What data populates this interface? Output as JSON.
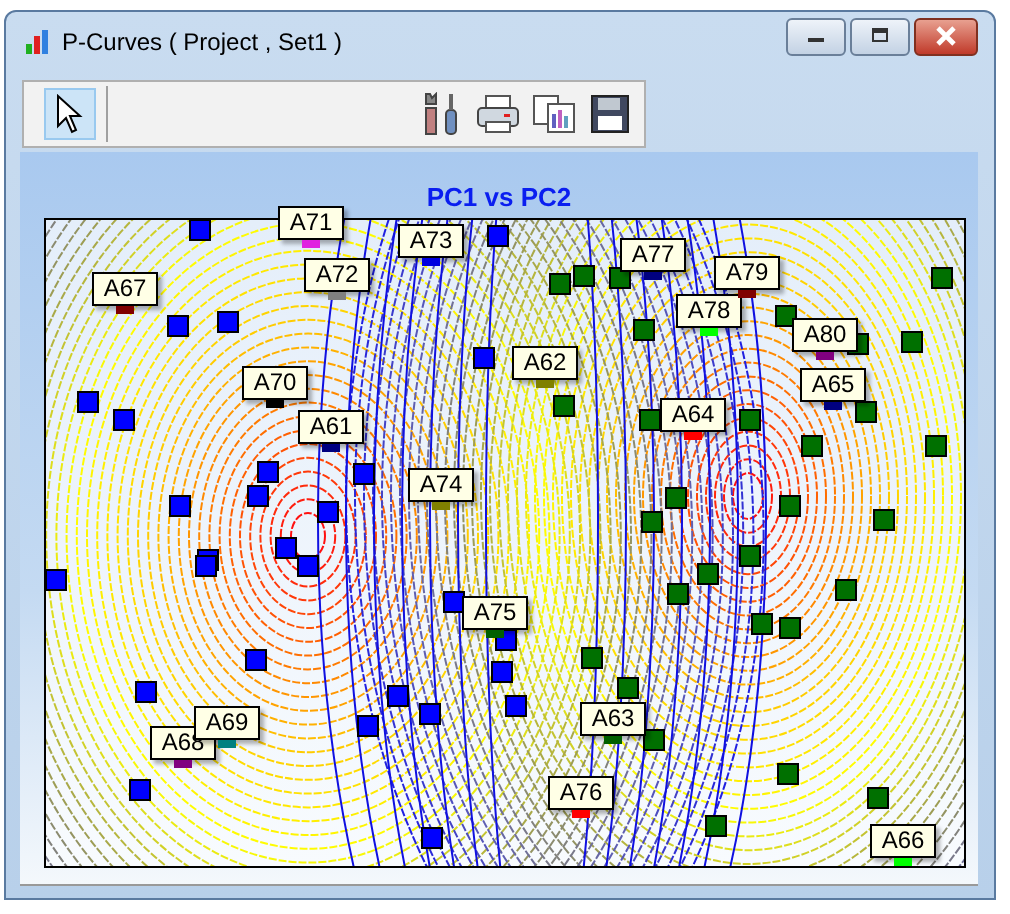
{
  "window": {
    "title": "P-Curves ( Project , Set1 )"
  },
  "toolbar": [
    {
      "kind": "pointer",
      "selected": true
    },
    {
      "kind": "tools",
      "selected": false
    },
    {
      "kind": "print",
      "selected": false
    },
    {
      "kind": "copy",
      "selected": false
    },
    {
      "kind": "save",
      "selected": false
    }
  ],
  "chart": {
    "title": "PC1 vs PC2",
    "labels": [
      {
        "text": "A71",
        "color": "#e020e0"
      },
      {
        "text": "A73",
        "color": "#0000e0"
      },
      {
        "text": "A72",
        "color": "#808080"
      },
      {
        "text": "A67",
        "color": "#800000"
      },
      {
        "text": "A77",
        "color": "#000080"
      },
      {
        "text": "A79",
        "color": "#800000"
      },
      {
        "text": "A78",
        "color": "#00ff00"
      },
      {
        "text": "A80",
        "color": "#800080"
      },
      {
        "text": "A62",
        "color": "#808000"
      },
      {
        "text": "A65",
        "color": "#000080"
      },
      {
        "text": "A70",
        "color": "#000000"
      },
      {
        "text": "A64",
        "color": "#ff0000"
      },
      {
        "text": "A61",
        "color": "#000080"
      },
      {
        "text": "A74",
        "color": "#808000"
      },
      {
        "text": "A75",
        "color": "#006000"
      },
      {
        "text": "A63",
        "color": "#006000"
      },
      {
        "text": "A69",
        "color": "#008080"
      },
      {
        "text": "A68",
        "color": "#800080"
      },
      {
        "text": "A76",
        "color": "#ff0000"
      },
      {
        "text": "A66",
        "color": "#00ff00"
      }
    ]
  }
}
